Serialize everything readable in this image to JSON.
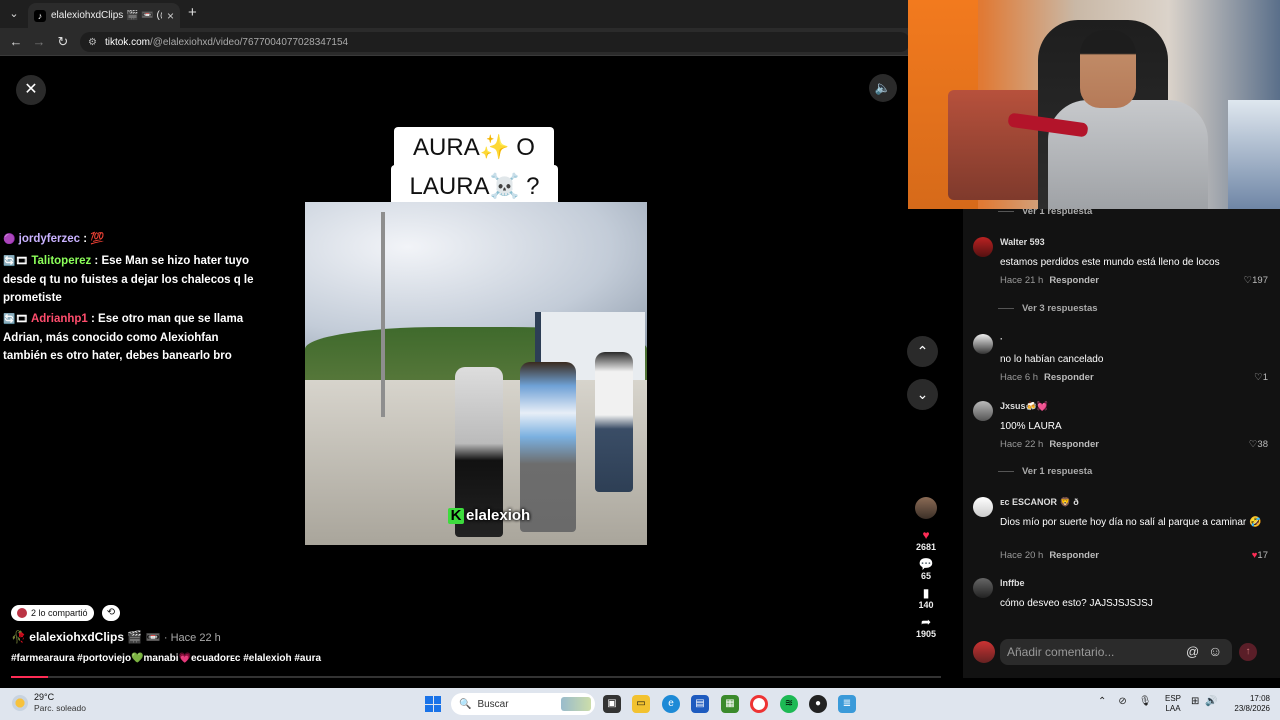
{
  "browser": {
    "tab_title": "elalexiohxdClips 🎬 📼 (@el",
    "tab_favicon": "tiktok-icon",
    "new_tab": "+",
    "url_host": "tiktok.com",
    "url_path": "/@elalexiohxd/video/7677004077028347154"
  },
  "player": {
    "caption_line1": "AURA✨ O",
    "caption_line2": "LAURA☠️ ?",
    "watermark": "elalexioh",
    "watermark_badge": "K"
  },
  "chat": [
    {
      "user": "jordyferzec",
      "badge": "🟣",
      "sep": " : ",
      "message": "💯"
    },
    {
      "user": "Talitoperez",
      "badge": "🔄🎞",
      "sep": " : ",
      "message": "Ese Man se hizo hater tuyo desde q tu no fuistes a dejar los chalecos q le prometiste"
    },
    {
      "user": "Adrianhp1",
      "badge": "🔄🎞",
      "sep": " : ",
      "message": "Ese otro man que se llama Adrian, más conocido como Alexiohfan también es otro hater, debes banearlo bro"
    }
  ],
  "video_info": {
    "shared_text": "2 lo compartió",
    "author": "elalexiohxdClips 🎬 📼",
    "author_prefix": "🥀",
    "time": "· Hace 22 h",
    "hashtags": "#farmearaura #portoviejo💚manabi💗ecuadorᴇᴄ #elalexioh #aura",
    "progress": 0.04
  },
  "actions": {
    "likes": "2681",
    "comments": "65",
    "saves": "140",
    "shares": "1905"
  },
  "comments": {
    "items": [
      {
        "more": "Ver 1 respuesta"
      },
      {
        "user": "Walter 593",
        "text": "estamos perdidos este mundo está lleno de locos",
        "time": "Hace 21 h",
        "reply": "Responder",
        "likes": "197",
        "liked": false,
        "more": "Ver 3 respuestas"
      },
      {
        "user": "·",
        "text": "no lo habían cancelado",
        "time": "Hace 6 h",
        "reply": "Responder",
        "likes": "1",
        "liked": false
      },
      {
        "user": "Jxsus🍻💓",
        "text": "100% LAURA",
        "time": "Hace 22 h",
        "reply": "Responder",
        "likes": "38",
        "liked": false,
        "more": "Ver 1 respuesta"
      },
      {
        "user": "ᴇᴄ ESCANOR 🦁 ð",
        "text": "Dios mío por suerte hoy día no salí al parque a caminar 🤣",
        "time": "Hace 20 h",
        "reply": "Responder",
        "likes": "17",
        "liked": true
      },
      {
        "user": "lnffbe",
        "text": "cómo desveo esto? JAJSJSJSJSJ"
      }
    ],
    "input_placeholder": "Añadir comentario..."
  },
  "taskbar": {
    "temp": "29°C",
    "weather": "Parc. soleado",
    "search": "Buscar",
    "lang1": "ESP",
    "lang2": "LAA",
    "time": "17:08",
    "date": "23/8/2026"
  },
  "colors": {
    "accent": "#fe2c55",
    "panel": "#121212",
    "taskbar": "#dfe5ee"
  }
}
